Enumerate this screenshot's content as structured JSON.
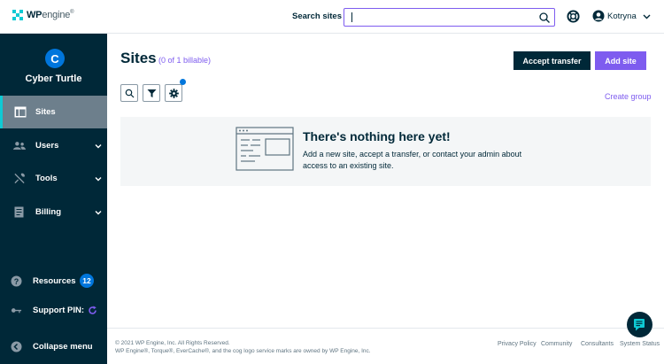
{
  "brand": {
    "logo_bold": "WP",
    "logo_light": "engine",
    "logo_mark": "®"
  },
  "header": {
    "search_label": "Search sites",
    "search_value": "",
    "search_placeholder": "",
    "user_name": "Kotryna",
    "icons": [
      "search-icon",
      "help-lifebuoy-icon",
      "user-avatar-icon",
      "chevron-down-icon"
    ]
  },
  "sidebar": {
    "org_initial": "C",
    "org_name": "Cyber Turtle",
    "items": [
      {
        "label": "Sites",
        "icon": "layout-icon",
        "active": true
      },
      {
        "label": "Users",
        "icon": "users-icon",
        "expandable": true
      },
      {
        "label": "Tools",
        "icon": "tools-icon",
        "expandable": true
      },
      {
        "label": "Billing",
        "icon": "billing-icon",
        "expandable": true
      }
    ],
    "resources_label": "Resources",
    "resources_count": "12",
    "support_pin_label": "Support PIN:",
    "collapse_label": "Collapse menu"
  },
  "main": {
    "title": "Sites",
    "billable": "(0 of 1 billable)",
    "accept_transfer": "Accept transfer",
    "add_site": "Add site",
    "create_group": "Create group",
    "empty_title": "There's nothing here yet!",
    "empty_desc": "Add a new site, accept a transfer, or contact your admin about access to an existing site."
  },
  "footer": {
    "copyright_line1": "© 2021 WP Engine, Inc. All Rights Reserved.",
    "copyright_line2": "WP Engine®, Torque®, EverCache®, and the cog logo service marks are owned by WP Engine, Inc.",
    "links": [
      "Privacy Policy",
      "Community",
      "Consultants",
      "System Status"
    ]
  },
  "colors": {
    "navy": "#002838",
    "accent_purple": "#7e5cef",
    "teal": "#0ecad4",
    "blue": "#0076dc",
    "active_nav": "#6d7f8c",
    "panel_bg": "#f4f6f7"
  }
}
